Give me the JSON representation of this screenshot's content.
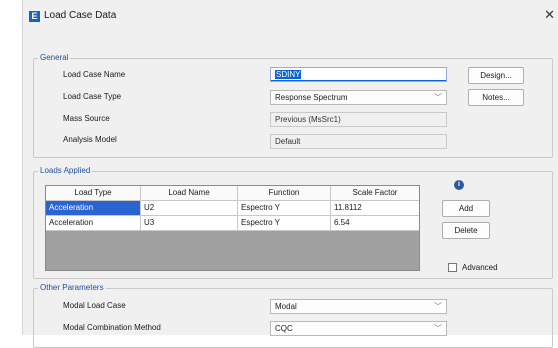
{
  "window": {
    "title": "Load Case Data",
    "app_icon": "E",
    "close_glyph": "✕"
  },
  "general": {
    "legend": "General",
    "name_label": "Load Case Name",
    "name_value": "SDINY",
    "type_label": "Load Case Type",
    "type_value": "Response Spectrum",
    "mass_label": "Mass Source",
    "mass_value": "Previous  (MsSrc1)",
    "analysis_label": "Analysis Model",
    "analysis_value": "Default",
    "design_button": "Design...",
    "notes_button": "Notes..."
  },
  "loads": {
    "legend": "Loads Applied",
    "columns": [
      "Load Type",
      "Load Name",
      "Function",
      "Scale Factor"
    ],
    "rows": [
      {
        "type": "Acceleration",
        "name": "U2",
        "function": "Espectro Y",
        "scale": "11.8112"
      },
      {
        "type": "Acceleration",
        "name": "U3",
        "function": "Espectro Y",
        "scale": "6.54"
      }
    ],
    "info_icon": "i",
    "add_button": "Add",
    "delete_button": "Delete",
    "advanced_label": "Advanced"
  },
  "other": {
    "legend": "Other Parameters",
    "modal_case_label": "Modal Load Case",
    "modal_case_value": "Modal",
    "modal_comb_label": "Modal Combination Method",
    "modal_comb_value": "CQC"
  },
  "icons": {
    "dropdown": "chevron-down-icon",
    "info": "info-icon",
    "close": "close-icon"
  },
  "colors": {
    "accent": "#0a64d8",
    "selected_row": "#2a64d0",
    "legend": "#1f4e9c"
  }
}
